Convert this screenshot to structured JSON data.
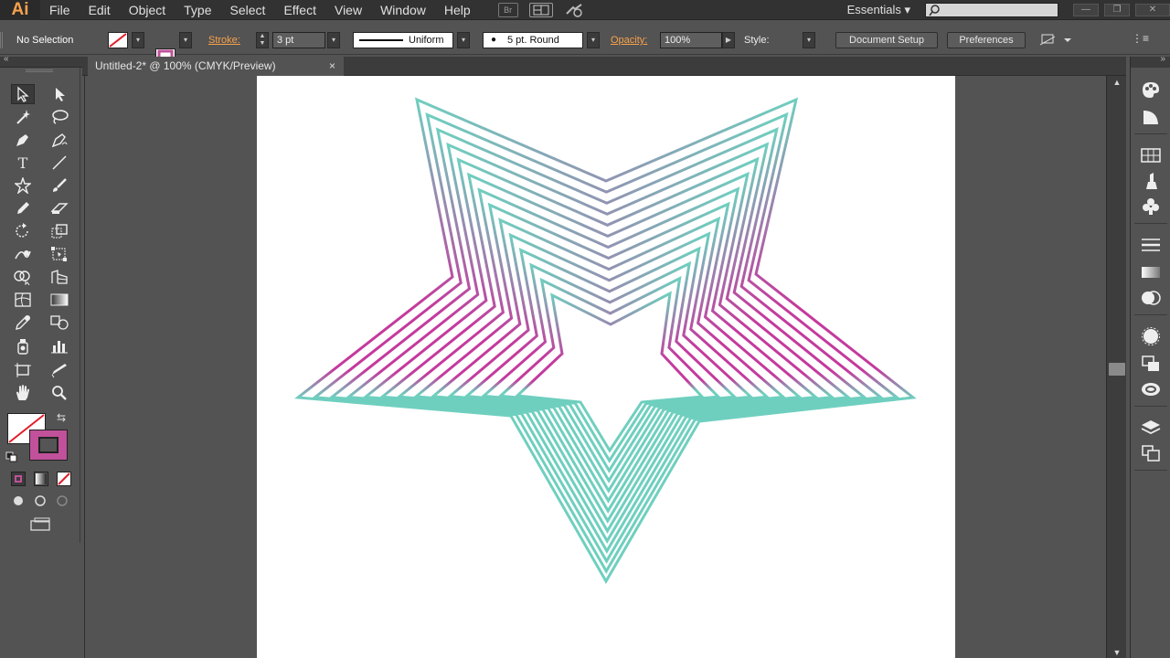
{
  "app": {
    "logo": "Ai"
  },
  "menu": [
    "File",
    "Edit",
    "Object",
    "Type",
    "Select",
    "Effect",
    "View",
    "Window",
    "Help"
  ],
  "menu_right": {
    "bridge": "Br",
    "workspace": "Essentials",
    "workspace_arrow": "▾"
  },
  "control": {
    "selection": "No Selection",
    "stroke_label": "Stroke:",
    "stroke_weight": "3 pt",
    "profile": "Uniform",
    "brush": "5 pt. Round",
    "opacity_label": "Opacity:",
    "opacity": "100%",
    "style_label": "Style:",
    "document_setup": "Document Setup",
    "preferences": "Preferences",
    "arrow": "▾"
  },
  "document": {
    "tab_title": "Untitled-2* @ 100% (CMYK/Preview)",
    "close": "×"
  },
  "colors": {
    "teal": "#6fcfbf",
    "magenta": "#c43a9d",
    "fill_swatch": "#c0519a",
    "stroke_none": "#e01e2b"
  },
  "icons": {
    "tools": [
      "selection",
      "direct-selection",
      "magic-wand",
      "lasso",
      "pen",
      "curvature",
      "type",
      "line-segment",
      "star",
      "paintbrush",
      "pencil",
      "eraser",
      "rotate",
      "scale",
      "warp",
      "free-transform",
      "shape-builder",
      "perspective",
      "mesh",
      "gradient",
      "eyedropper",
      "blend",
      "symbol-sprayer",
      "column-graph",
      "artboard",
      "slice",
      "hand",
      "zoom"
    ],
    "dock": [
      "color",
      "color-guide",
      "swatches",
      "brushes",
      "symbols",
      "stroke",
      "gradient",
      "transparency",
      "appearance",
      "graphic-styles",
      "libraries",
      "layers",
      "artboards"
    ]
  }
}
